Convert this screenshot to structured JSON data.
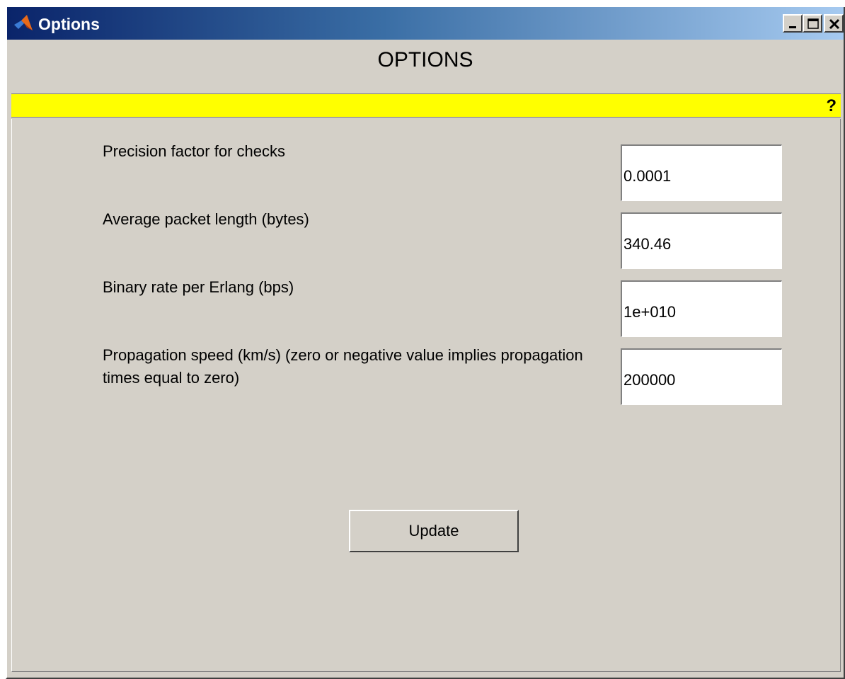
{
  "window": {
    "title": "Options",
    "icon": "matlab-icon",
    "controls": [
      "minimize-icon",
      "maximize-icon",
      "close-icon"
    ]
  },
  "header": {
    "title": "OPTIONS"
  },
  "help_bar": {
    "help_label": "?",
    "color": "#ffff00"
  },
  "options": [
    {
      "label": "Precision factor for checks",
      "value": "0.0001"
    },
    {
      "label": "Average packet length (bytes)",
      "value": "340.46"
    },
    {
      "label": "Binary rate per Erlang (bps)",
      "value": "1e+010"
    },
    {
      "label": "Propagation speed (km/s) (zero or negative value implies propagation times equal to zero)",
      "value": "200000"
    }
  ],
  "update_button": {
    "label": "Update"
  }
}
